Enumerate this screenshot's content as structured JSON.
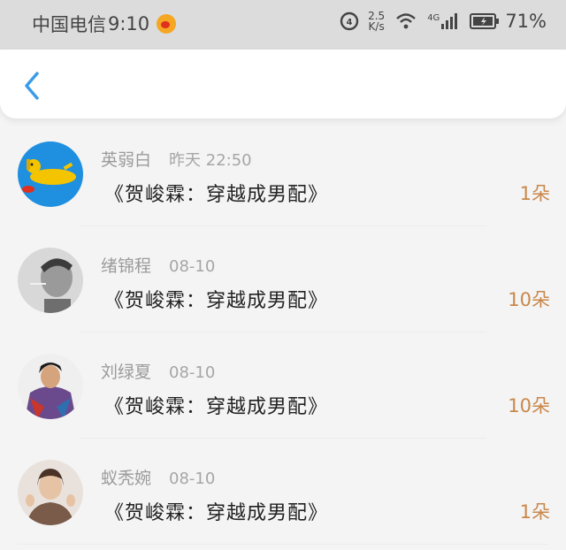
{
  "status_bar": {
    "carrier": "中国电信",
    "time": "9:10",
    "speed_value": "2.5",
    "speed_unit": "K/s",
    "network": "4G",
    "battery": "71%"
  },
  "nav": {
    "back_icon": "chevron-left-icon",
    "accent_color": "#3a9be8"
  },
  "records": [
    {
      "name": "英弱白",
      "date": "昨天 22:50",
      "book": "《贺峻霖：穿越成男配》",
      "amount": "1朵"
    },
    {
      "name": "绪锦程",
      "date": "08-10",
      "book": "《贺峻霖：穿越成男配》",
      "amount": "10朵"
    },
    {
      "name": "刘绿夏",
      "date": "08-10",
      "book": "《贺峻霖：穿越成男配》",
      "amount": "10朵"
    },
    {
      "name": "蚁秃婉",
      "date": "08-10",
      "book": "《贺峻霖：穿越成男配》",
      "amount": "1朵"
    }
  ]
}
